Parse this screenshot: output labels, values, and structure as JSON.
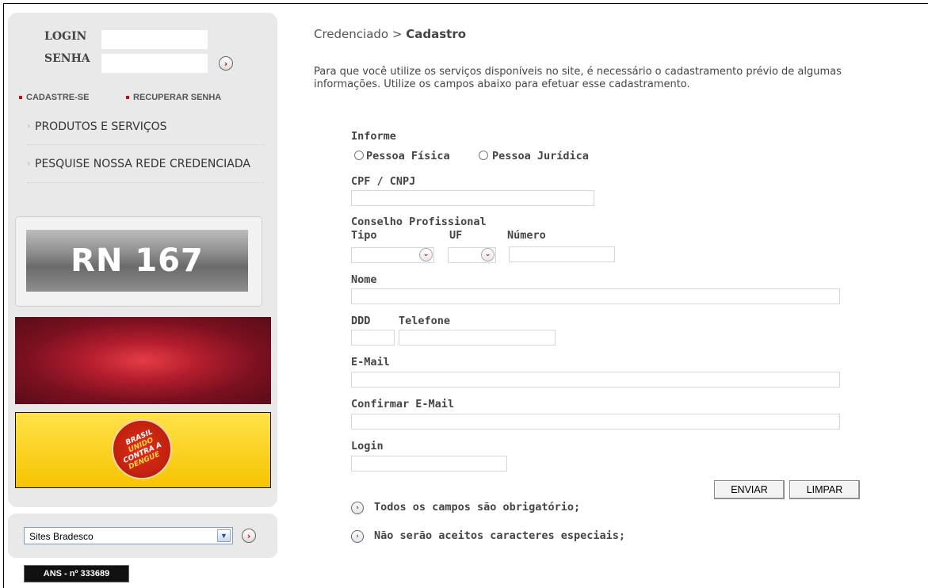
{
  "login": {
    "login_label": "LOGIN",
    "password_label": "SENHA",
    "login_value": "",
    "password_value": "",
    "submit_icon": "arrow-right-icon",
    "register_link": "CADASTRE-SE",
    "recover_link": "RECUPERAR SENHA"
  },
  "menu": {
    "items": [
      {
        "label": "PRODUTOS E SERVIÇOS"
      },
      {
        "label": "PESQUISE NOSSA REDE CREDENCIADA"
      }
    ]
  },
  "banners": {
    "rn_text": "RN 167",
    "dengue_lines": [
      "BRASIL",
      "UNIDO",
      "CONTRA A",
      "DENGUE"
    ]
  },
  "bottom": {
    "sites_select_value": "Sites Bradesco",
    "ans_badge": "ANS - nº 333689"
  },
  "breadcrumb": {
    "parent": "Credenciado",
    "separator": ">",
    "current": "Cadastro"
  },
  "intro": {
    "line1": "Para que você utilize os serviços disponíveis no site, é necessário o cadastramento prévio de algumas",
    "line2": "informações. Utilize os campos abaixo para efetuar esse cadastramento."
  },
  "form": {
    "informe_label": "Informe",
    "person_types": [
      "Pessoa Física",
      "Pessoa Jurídica"
    ],
    "cpf_label": "CPF / CNPJ",
    "council_label": "Conselho Profissional",
    "tipo_label": "Tipo",
    "uf_label": "UF",
    "numero_label": "Número",
    "nome_label": "Nome",
    "ddd_label": "DDD",
    "telefone_label": "Telefone",
    "email_label": "E-Mail",
    "confirm_email_label": "Confirmar E-Mail",
    "login_label": "Login",
    "send_button": "ENVIAR",
    "clear_button": "LIMPAR"
  },
  "notes": [
    "Todos os campos são obrigatório;",
    "Não serão aceitos caracteres especiais;"
  ],
  "colors": {
    "sidebar_bg": "#e9e9e9",
    "accent_red": "#cc0000",
    "text": "#444444"
  }
}
